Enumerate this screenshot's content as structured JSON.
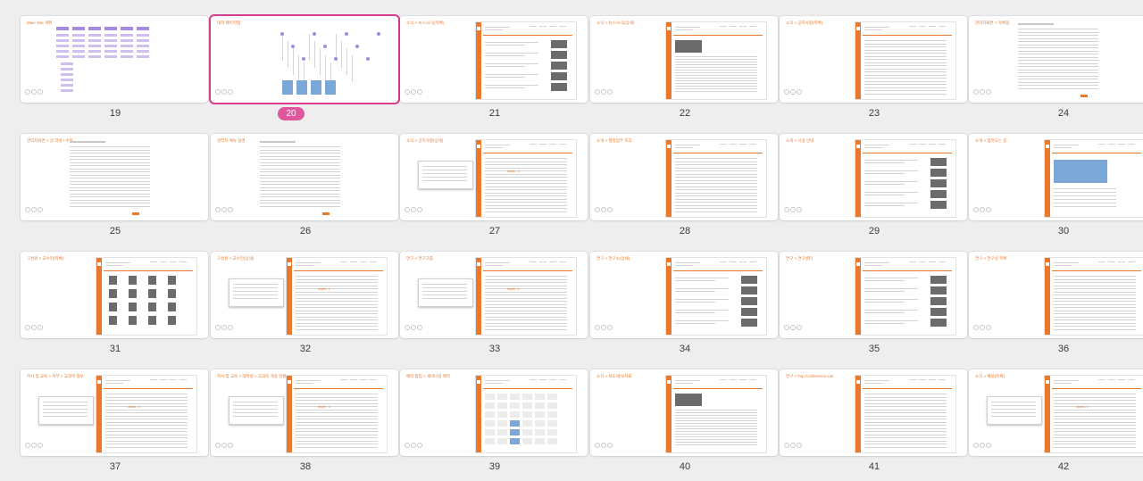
{
  "app": {
    "title": "Slide navigator"
  },
  "selected_page": "20",
  "slides": [
    {
      "page": "19",
      "title": "Main Site 개편",
      "kind": "diagram"
    },
    {
      "page": "20",
      "title": "대학 페이지맵",
      "kind": "map"
    },
    {
      "page": "21",
      "title": "소식 > 뉴스/소식(목록)",
      "kind": "site-gallery"
    },
    {
      "page": "22",
      "title": "소식 > 뉴스/소식(상세)",
      "kind": "site-text"
    },
    {
      "page": "23",
      "title": "소식 > 공지사항(목록)",
      "kind": "site-list"
    },
    {
      "page": "24",
      "title": "관리자화면 > 목록형",
      "kind": "admin-list"
    },
    {
      "page": "25",
      "title": "관리자화면 > 글 작성 / 수정",
      "kind": "admin-form"
    },
    {
      "page": "26",
      "title": "관리자 메뉴 설명",
      "kind": "admin-list"
    },
    {
      "page": "27",
      "title": "소식 > 공지사항(상세)",
      "kind": "site-popup"
    },
    {
      "page": "28",
      "title": "소개 > 행정업무 조직",
      "kind": "site-list"
    },
    {
      "page": "29",
      "title": "소개 > 시설 안내",
      "kind": "site-gallery"
    },
    {
      "page": "30",
      "title": "소개 > 찾아오는 길",
      "kind": "site-map"
    },
    {
      "page": "31",
      "title": "구성원 > 교수진(목록)",
      "kind": "site-people"
    },
    {
      "page": "32",
      "title": "구성원 > 교수진(상세)",
      "kind": "site-popup"
    },
    {
      "page": "33",
      "title": "연구 > 연구그룹",
      "kind": "site-popup"
    },
    {
      "page": "34",
      "title": "연구 > 연구소(상세)",
      "kind": "site-gallery"
    },
    {
      "page": "35",
      "title": "연구 > 연구센터",
      "kind": "site-gallery"
    },
    {
      "page": "36",
      "title": "연구 > 연구실 목록",
      "kind": "site-list"
    },
    {
      "page": "37",
      "title": "학사 및 교육 > 학부 > 교과목 정보",
      "kind": "site-popup"
    },
    {
      "page": "38",
      "title": "학사 및 교육 > 대학원 > 교과목 개설 현황",
      "kind": "site-popup"
    },
    {
      "page": "39",
      "title": "예약 팝업 > 세미나실 예약",
      "kind": "site-calendar"
    },
    {
      "page": "40",
      "title": "소식 > 보도/홍보자료",
      "kind": "site-text"
    },
    {
      "page": "41",
      "title": "연구 > Top Conference List",
      "kind": "site-list"
    },
    {
      "page": "42",
      "title": "소식 > 채용(목록)",
      "kind": "site-popup"
    }
  ],
  "colors": {
    "accent": "#e8792f",
    "selection": "#e0579d",
    "background": "#eeeeef"
  }
}
